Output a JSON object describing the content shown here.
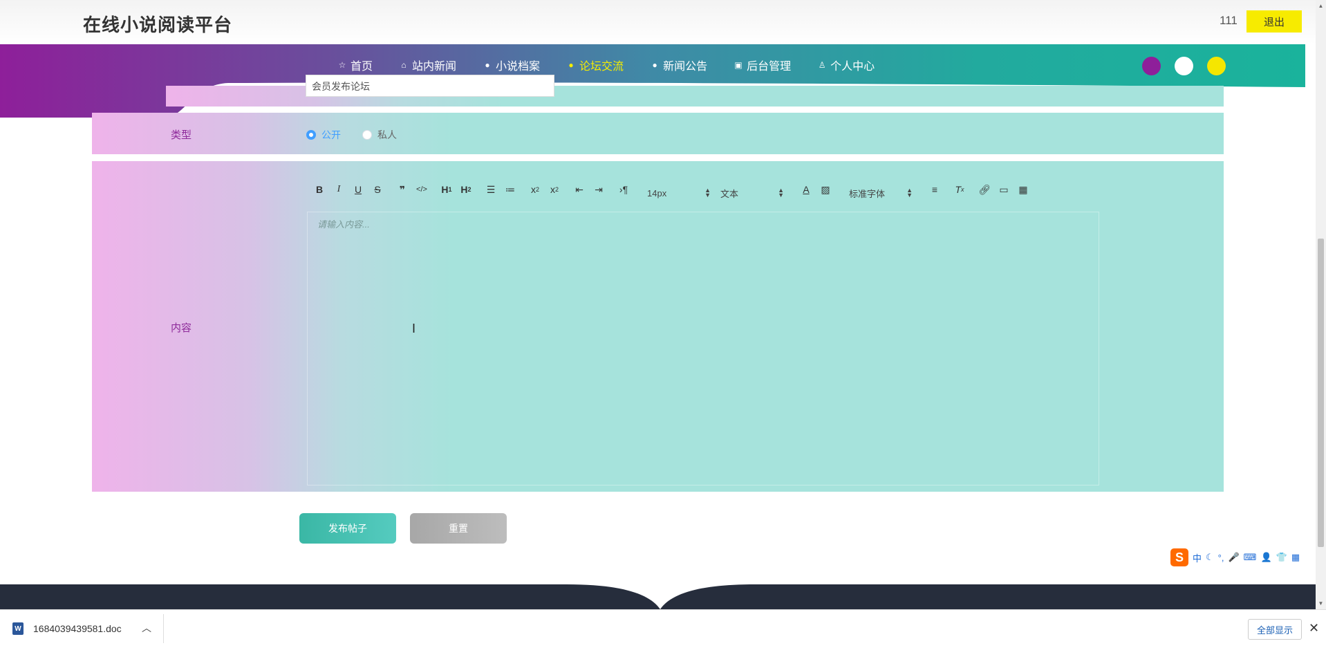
{
  "header": {
    "site_title": "在线小说阅读平台",
    "user_count": "111",
    "logout_label": "退出"
  },
  "nav": {
    "items": [
      {
        "label": "首页",
        "icon": "star-icon"
      },
      {
        "label": "站内新闻",
        "icon": "bag-icon"
      },
      {
        "label": "小说档案",
        "icon": "info-icon"
      },
      {
        "label": "论坛交流",
        "icon": "question-icon",
        "active": true
      },
      {
        "label": "新闻公告",
        "icon": "info-icon"
      },
      {
        "label": "后台管理",
        "icon": "calendar-icon"
      },
      {
        "label": "个人中心",
        "icon": "user-icon"
      }
    ],
    "theme_dots": [
      "#8e1f9a",
      "#ffffff",
      "#f5e600"
    ],
    "gradient_colors": [
      "#8e1f9a",
      "#1ab39c"
    ]
  },
  "form": {
    "title_value": "会员发布论坛",
    "type_label": "类型",
    "type_options": [
      {
        "label": "公开",
        "checked": true
      },
      {
        "label": "私人",
        "checked": false
      }
    ],
    "content_label": "内容",
    "editor": {
      "font_size": "14px",
      "block_type": "文本",
      "font_family": "标准字体",
      "placeholder": "请输入内容..."
    },
    "submit_label": "发布帖子",
    "reset_label": "重置"
  },
  "ime": {
    "items": [
      "中",
      "☾",
      "°,",
      "🎤",
      "⌨",
      "👤",
      "👕",
      "▦"
    ]
  },
  "download_bar": {
    "file_name": "1684039439581.doc",
    "show_all_label": "全部显示"
  }
}
